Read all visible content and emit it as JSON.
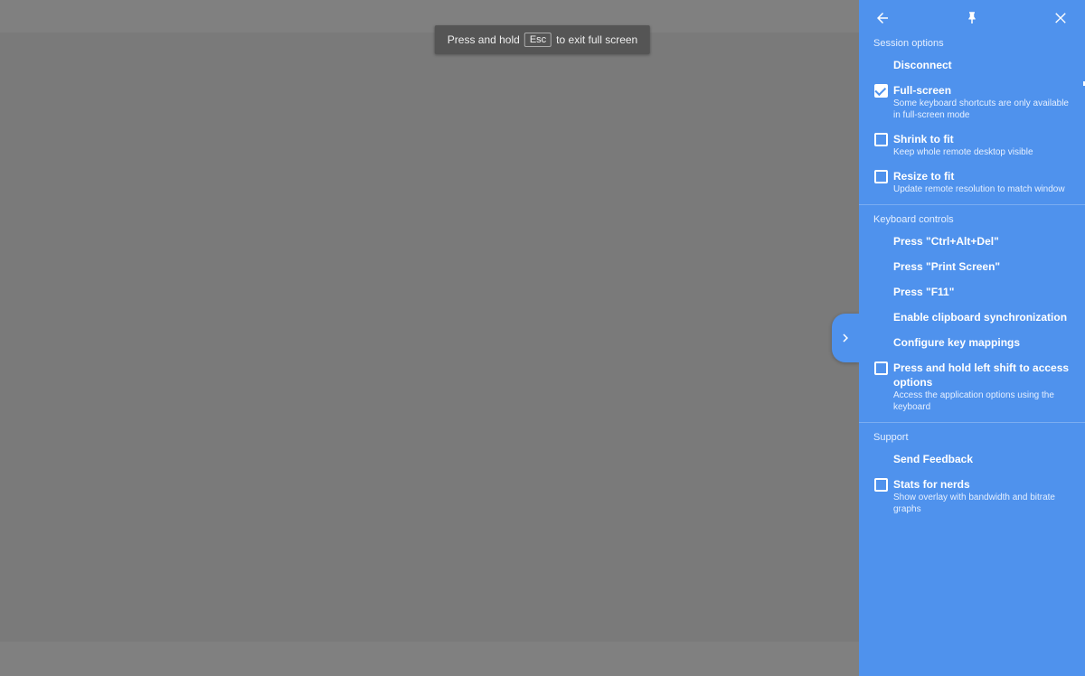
{
  "hint": {
    "prefix": "Press and hold",
    "key": "Esc",
    "suffix": "to exit full screen"
  },
  "panel": {
    "session_options": {
      "label": "Session options",
      "disconnect": "Disconnect",
      "fullscreen": {
        "title": "Full-screen",
        "desc": "Some keyboard shortcuts are only available in full-screen mode",
        "checked": true
      },
      "shrink": {
        "title": "Shrink to fit",
        "desc": "Keep whole remote desktop visible",
        "checked": false
      },
      "resize": {
        "title": "Resize to fit",
        "desc": "Update remote resolution to match window",
        "checked": false
      }
    },
    "keyboard": {
      "label": "Keyboard controls",
      "ctrl_alt_del": "Press \"Ctrl+Alt+Del\"",
      "print_screen": "Press \"Print Screen\"",
      "f11": "Press \"F11\"",
      "clipboard": "Enable clipboard synchronization",
      "keymaps": "Configure key mappings",
      "left_shift": {
        "title": "Press and hold left shift to access options",
        "desc": "Access the application options using the keyboard",
        "checked": false
      }
    },
    "support": {
      "label": "Support",
      "feedback": "Send Feedback",
      "stats": {
        "title": "Stats for nerds",
        "desc": "Show overlay with bandwidth and bitrate graphs",
        "checked": false
      }
    }
  }
}
